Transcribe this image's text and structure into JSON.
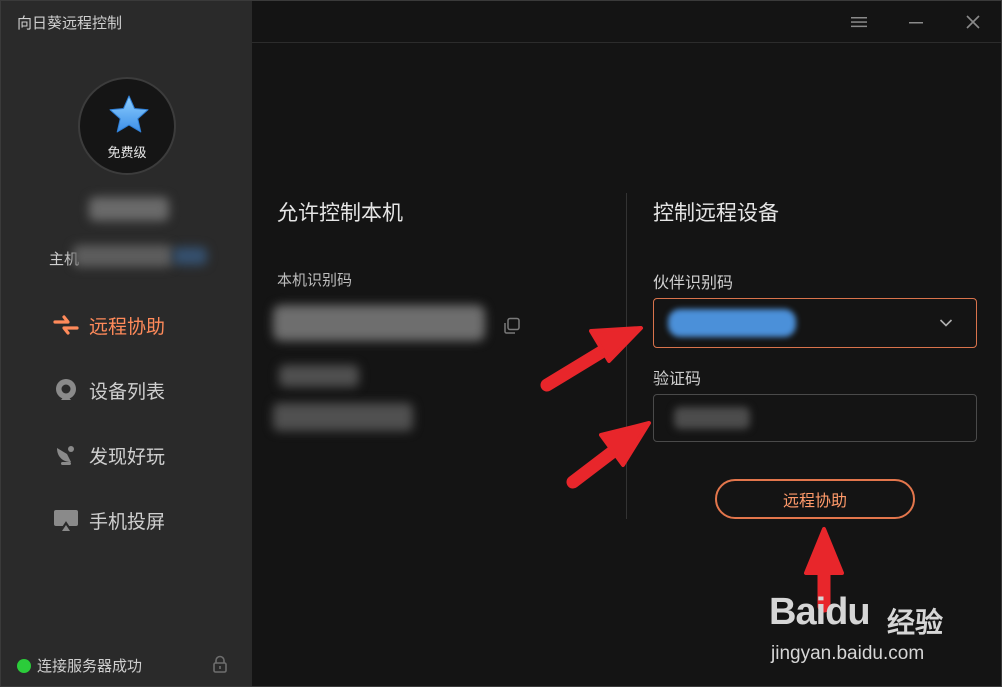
{
  "app": {
    "title": "向日葵远程控制"
  },
  "user": {
    "tier": "免费级",
    "host_label_prefix": "主机"
  },
  "nav": [
    {
      "label": "远程协助",
      "icon": "remote-assist-icon",
      "active": true
    },
    {
      "label": "设备列表",
      "icon": "device-list-icon",
      "active": false
    },
    {
      "label": "发现好玩",
      "icon": "discover-icon",
      "active": false
    },
    {
      "label": "手机投屏",
      "icon": "screen-cast-icon",
      "active": false
    }
  ],
  "status": {
    "text": "连接服务器成功",
    "color": "#2bcc3a"
  },
  "local": {
    "title": "允许控制本机",
    "id_label": "本机识别码"
  },
  "remote": {
    "title": "控制远程设备",
    "partner_label": "伙伴识别码",
    "code_label": "验证码",
    "button": "远程协助"
  },
  "watermark": {
    "brand": "Baidu",
    "brand_cn": "经验",
    "url": "jingyan.baidu.com"
  },
  "colors": {
    "accent": "#e3764c",
    "arrow": "#e8262b",
    "sidebar": "#2a2a2a",
    "background": "#141414"
  }
}
